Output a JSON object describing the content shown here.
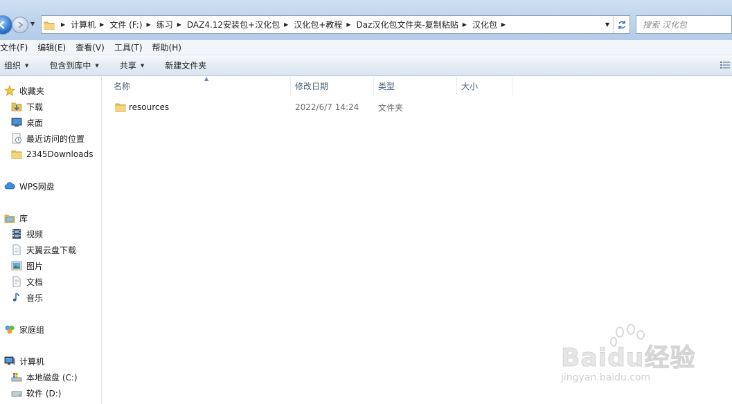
{
  "address_bar": {
    "crumbs": [
      "计算机",
      "文件 (F:)",
      "练习",
      "DAZ4.12安装包+汉化包",
      "汉化包+教程",
      "Daz汉化包文件夹-复制粘贴",
      "汉化包"
    ]
  },
  "search": {
    "placeholder": "搜索 汉化包"
  },
  "menubar": {
    "items": [
      "文件(F)",
      "编辑(E)",
      "查看(V)",
      "工具(T)",
      "帮助(H)"
    ]
  },
  "toolbar": {
    "organize": "组织",
    "include_in_library": "包含到库中",
    "share": "共享",
    "new_folder": "新建文件夹"
  },
  "nav": {
    "favorites": {
      "label": "收藏夹",
      "items": [
        "下载",
        "桌面",
        "最近访问的位置",
        "2345Downloads"
      ]
    },
    "wps": "WPS网盘",
    "libraries": {
      "label": "库",
      "items": [
        "视频",
        "天翼云盘下载",
        "图片",
        "文档",
        "音乐"
      ]
    },
    "homegroup": "家庭组",
    "computer": {
      "label": "计算机",
      "items": [
        "本地磁盘 (C:)",
        "软件 (D:)"
      ]
    }
  },
  "file_list": {
    "columns": {
      "name": "名称",
      "date": "修改日期",
      "type": "类型",
      "size": "大小"
    },
    "rows": [
      {
        "name": "resources",
        "date": "2022/6/7 14:24",
        "type": "文件夹",
        "size": ""
      }
    ]
  },
  "watermark": {
    "brand": "Baidu",
    "suffix": "经验",
    "url": "jingyan.baidu.com"
  },
  "colors": {
    "accent": "#3a6fb5",
    "folder": "#e9c15a"
  }
}
